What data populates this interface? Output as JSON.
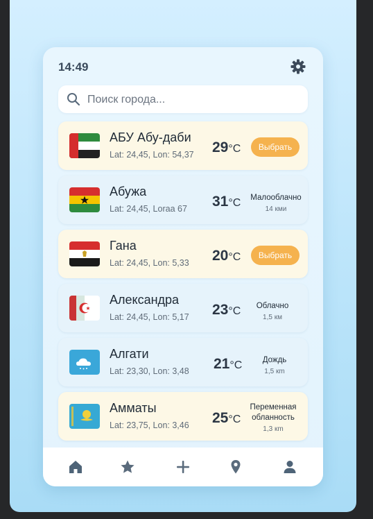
{
  "status": {
    "time": "14:49"
  },
  "icons": {
    "settings": "gear-icon",
    "search": "search-icon"
  },
  "search": {
    "placeholder": "Поиск города..."
  },
  "colors": {
    "accent": "#f5b24e",
    "warm_row": "#fdf8e6",
    "cool_row": "#e6f3fb",
    "nav_icon": "#5a6b7c"
  },
  "cities": [
    {
      "name": "АБУ Абу-даби",
      "coords": "Lat: 24,45, Lon: 54,37",
      "temp": "29",
      "unit": "°C",
      "action": "Выбрать",
      "flag": "uae-flag"
    },
    {
      "name": "Абужа",
      "coords": "Lat: 24,45, Loraa 67",
      "temp": "31",
      "unit": "°C",
      "condition": "Малооблачно",
      "detail": "14 кми",
      "flag": "ghana-flag"
    },
    {
      "name": "Гана",
      "coords": "Lat: 24,45, Lon: 5,33",
      "temp": "20",
      "unit": "°C",
      "action": "Выбрать",
      "flag": "egypt-flag"
    },
    {
      "name": "Александра",
      "coords": "Lat: 24,45, Lon: 5,17",
      "temp": "23",
      "unit": "°C",
      "condition": "Облачно",
      "detail": "1,5 км",
      "flag": "algeria-flag"
    },
    {
      "name": "Алгати",
      "coords": "Lat: 23,30, Lon: 3,48",
      "temp": "21",
      "unit": "°C",
      "condition": "Дождь",
      "detail": "1,5 кm",
      "flag": "cloud-weather-icon"
    },
    {
      "name": "Амматы",
      "coords": "Lat: 23,75, Lon: 3,46",
      "temp": "25",
      "unit": "°C",
      "condition": "Переменная",
      "condition2": "обланность",
      "detail": "1,3 кm",
      "flag": "kazakhstan-flag"
    }
  ],
  "nav": [
    "home-icon",
    "star-icon",
    "plus-icon",
    "location-pin-icon",
    "user-icon"
  ]
}
